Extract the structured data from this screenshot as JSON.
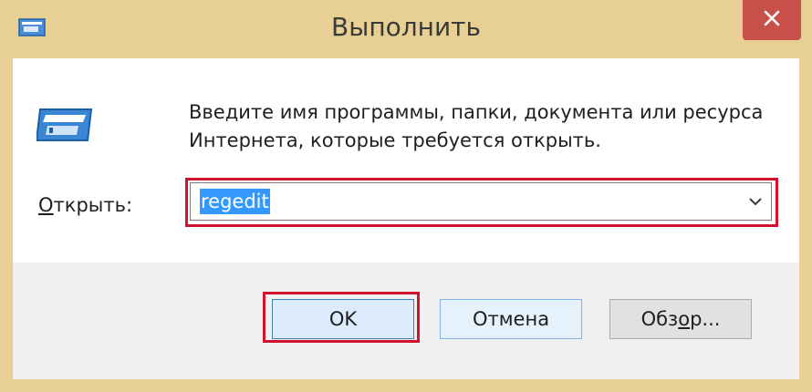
{
  "window": {
    "title": "Выполнить"
  },
  "prompt": {
    "line1": "Введите имя программы, папки, документа или ресурса",
    "line2": "Интернета, которые требуется открыть."
  },
  "open_field": {
    "label_mnemonic": "О",
    "label_rest": "ткрыть:",
    "value": "regedit"
  },
  "buttons": {
    "ok_label": "OK",
    "cancel_label": "Отмена",
    "browse_before": "Обз",
    "browse_mnemonic": "о",
    "browse_after": "р..."
  },
  "icons": {
    "window_icon": "run-icon",
    "close": "close-icon",
    "dropdown": "chevron-down-icon"
  },
  "colors": {
    "frame": "#e8cf93",
    "close_button": "#c7504a",
    "highlight": "#d1122e",
    "selection": "#3399ff"
  }
}
